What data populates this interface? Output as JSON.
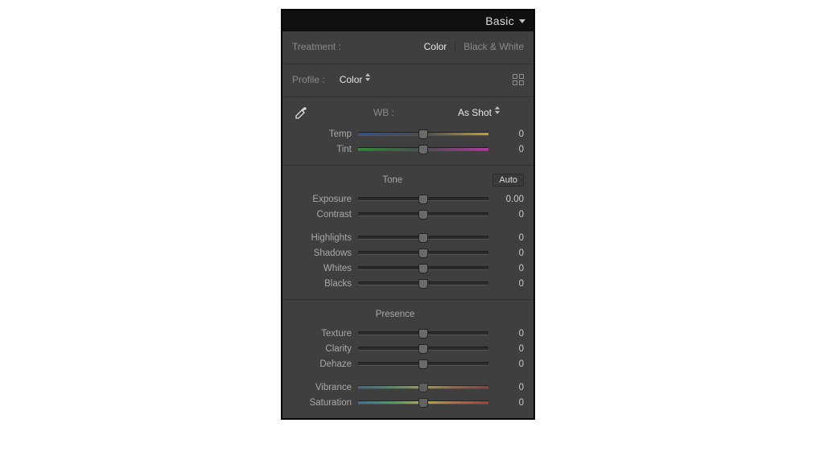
{
  "title": "Basic",
  "treatment": {
    "label": "Treatment :",
    "color": "Color",
    "bw": "Black & White"
  },
  "profile": {
    "label": "Profile :",
    "value": "Color"
  },
  "wb": {
    "label": "WB :",
    "value": "As Shot",
    "temp": {
      "label": "Temp",
      "value": "0",
      "pos": 50
    },
    "tint": {
      "label": "Tint",
      "value": "0",
      "pos": 50
    }
  },
  "tone": {
    "label": "Tone",
    "auto": "Auto",
    "exposure": {
      "label": "Exposure",
      "value": "0.00",
      "pos": 50
    },
    "contrast": {
      "label": "Contrast",
      "value": "0",
      "pos": 50
    },
    "highlights": {
      "label": "Highlights",
      "value": "0",
      "pos": 50
    },
    "shadows": {
      "label": "Shadows",
      "value": "0",
      "pos": 50
    },
    "whites": {
      "label": "Whites",
      "value": "0",
      "pos": 50
    },
    "blacks": {
      "label": "Blacks",
      "value": "0",
      "pos": 50
    }
  },
  "presence": {
    "label": "Presence",
    "texture": {
      "label": "Texture",
      "value": "0",
      "pos": 50
    },
    "clarity": {
      "label": "Clarity",
      "value": "0",
      "pos": 50
    },
    "dehaze": {
      "label": "Dehaze",
      "value": "0",
      "pos": 50
    },
    "vibrance": {
      "label": "Vibrance",
      "value": "0",
      "pos": 50
    },
    "saturation": {
      "label": "Saturation",
      "value": "0",
      "pos": 50
    }
  }
}
